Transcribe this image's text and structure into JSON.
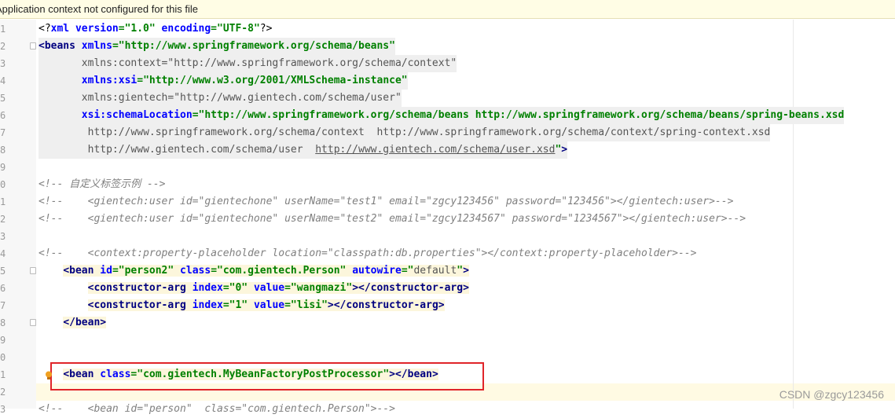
{
  "banner": {
    "text": "Application context not configured for this file"
  },
  "lines": [
    {
      "n": "1",
      "html": "<span class='plain'>&lt;?</span><span class='attr'>xml version</span><span class='val'>=\"1.0\"</span> <span class='attr'>encoding</span><span class='val'>=\"UTF-8\"</span><span class='plain'>?&gt;</span>",
      "hl": ""
    },
    {
      "n": "2",
      "html": "<span class='tag'>&lt;beans</span> <span class='attr'>xmlns</span><span class='val'>=\"http://www.springframework.org/schema/beans\"</span>",
      "hl": "gray",
      "fold": true
    },
    {
      "n": "3",
      "html": "       <span class='grayattr'>xmlns:context=\"http://www.springframework.org/schema/context\"</span>",
      "hl": "gray"
    },
    {
      "n": "4",
      "html": "       <span class='attr'>xmlns:xsi</span><span class='val'>=\"http://www.w3.org/2001/XMLSchema-instance\"</span>",
      "hl": "gray"
    },
    {
      "n": "5",
      "html": "       <span class='grayattr'>xmlns:gientech=\"http://www.gientech.com/schema/user\"</span>",
      "hl": "gray"
    },
    {
      "n": "6",
      "html": "       <span class='attr'>xsi:schemaLocation</span><span class='val'>=\"http://www.springframework.org/schema/beans http://www.springframework.org/schema/beans/spring-beans.xsd</span>",
      "hl": "gray"
    },
    {
      "n": "7",
      "html": "        <span class='grayattr'>http://www.springframework.org/schema/context  http://www.springframework.org/schema/context/spring-context.xsd</span>",
      "hl": "gray"
    },
    {
      "n": "8",
      "html": "        <span class='grayattr'>http://www.gientech.com/schema/user  <u>http://www.gientech.com/schema/user.xsd</u></span><span class='val'>\"</span><span class='tag'>&gt;</span>",
      "hl": "gray"
    },
    {
      "n": "9",
      "html": "",
      "hl": ""
    },
    {
      "n": "0",
      "html": "<span class='comment'>&lt;!-- 自定义标签示例 --&gt;</span>",
      "hl": ""
    },
    {
      "n": "1",
      "html": "<span class='comment'>&lt;!--    &lt;gientech:user id=\"gientechone\" userName=\"test1\" email=\"zgcy123456\" password=\"123456\"&gt;&lt;/gientech:user&gt;--&gt;</span>",
      "hl": ""
    },
    {
      "n": "2",
      "html": "<span class='comment'>&lt;!--    &lt;gientech:user id=\"gientechone\" userName=\"test2\" email=\"zgcy1234567\" password=\"1234567\"&gt;&lt;/gientech:user&gt;--&gt;</span>",
      "hl": ""
    },
    {
      "n": "3",
      "html": "",
      "hl": ""
    },
    {
      "n": "4",
      "html": "<span class='comment'>&lt;!--    &lt;context:property-placeholder location=\"classpath:db.properties\"&gt;&lt;/context:property-placeholder&gt;--&gt;</span>",
      "hl": ""
    },
    {
      "n": "5",
      "html": "    <span class='hl-yellow'><span class='tag'>&lt;bean</span> <span class='attr'>id</span><span class='val'>=\"person2\"</span> <span class='attr'>class</span><span class='val'>=\"com.gientech.Person\"</span> <span class='attr'>autowire</span><span class='val'>=\"</span><span class='grayattr'>default</span><span class='val'>\"</span><span class='tag'>&gt;</span></span>",
      "hl": "",
      "fold": true
    },
    {
      "n": "6",
      "html": "        <span class='hl-yellow'><span class='tag'>&lt;constructor-arg</span> <span class='attr'>index</span><span class='val'>=\"0\"</span> <span class='attr'>value</span><span class='val'>=\"wangmazi\"</span><span class='tag'>&gt;&lt;/constructor-arg&gt;</span></span>",
      "hl": ""
    },
    {
      "n": "7",
      "html": "        <span class='hl-yellow'><span class='tag'>&lt;constructor-arg</span> <span class='attr'>index</span><span class='val'>=\"1\"</span> <span class='attr'>value</span><span class='val'>=\"lisi\"</span><span class='tag'>&gt;&lt;/constructor-arg&gt;</span></span>",
      "hl": ""
    },
    {
      "n": "8",
      "html": "    <span class='hl-yellow'><span class='tag'>&lt;/bean&gt;</span></span>",
      "hl": "",
      "fold": true
    },
    {
      "n": "9",
      "html": "",
      "hl": ""
    },
    {
      "n": "0",
      "html": "",
      "hl": ""
    },
    {
      "n": "1",
      "html": "    <span class='hl-yellow'><span class='tag'>&lt;bean</span> <span class='attr'>class</span><span class='val'>=\"com.gientech.MyBeanFactoryPostProcessor\"</span><span class='tag'>&gt;&lt;/bean&gt;</span></span>",
      "hl": ""
    },
    {
      "n": "2",
      "html": "",
      "hl": ""
    },
    {
      "n": "3",
      "html": "<span class='comment'>&lt;!--    &lt;bean id=\"person\"  class=\"com.gientech.Person\"&gt;--&gt;</span>",
      "hl": ""
    }
  ],
  "watermark": {
    "text": "CSDN @zgcy123456"
  }
}
